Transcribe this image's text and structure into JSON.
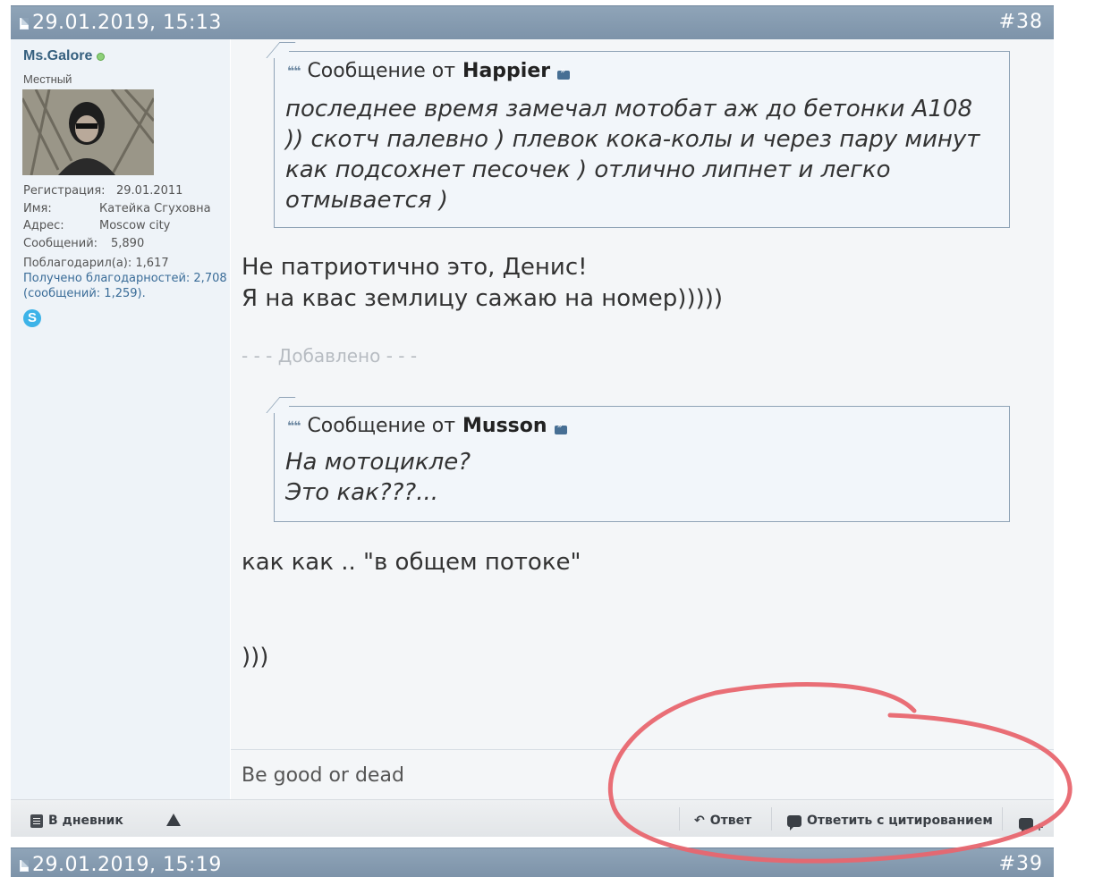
{
  "post_top": {
    "date": "29.01.2019, 15:13",
    "number": "#38"
  },
  "post_bottom": {
    "date": "29.01.2019, 15:19",
    "number": "#39"
  },
  "user": {
    "name": "Ms.Galore",
    "rank": "Местный",
    "info": [
      {
        "label": "Регистрация:",
        "value": "29.01.2011"
      },
      {
        "label": "Имя:",
        "value": "Катейка Сгуховна"
      },
      {
        "label": "Адрес:",
        "value": "Moscow city"
      },
      {
        "label": "Сообщений:",
        "value": "5,890"
      }
    ],
    "thanked": "Поблагодарил(а):  1,617",
    "received": "Получено благодарностей: 2,708 (сообщений: 1,259).",
    "skype_label": "S"
  },
  "quote1": {
    "prefix": "Сообщение от",
    "author": "Happier",
    "text": "последнее время замечал мотобат аж до бетонки А108\n)) скотч палевно ) плевок кока-колы и через пару минут\nкак подсохнет песочек ) отлично липнет и легко\nотмывается )"
  },
  "message1": "Не патриотично это, Денис!\nЯ на квас землицу сажаю на номер)))))",
  "added_label": "- - - Добавлено - - -",
  "quote2": {
    "prefix": "Сообщение от",
    "author": "Musson",
    "text": "На мотоцикле?\nЭто как???..."
  },
  "message2": "как как .. \"в общем потоке\"",
  "message3": ")))",
  "signature": "Be good or dead",
  "actions": {
    "diary": "В дневник",
    "reply": "Ответ",
    "reply_quote": "Ответить с цитированием"
  },
  "colors": {
    "header": "#8fa4b8",
    "annotation": "#e8666f",
    "username": "#36607f"
  },
  "icons": [
    "doc-icon",
    "online-icon",
    "quote-icon",
    "view-post-icon",
    "skype-icon",
    "diary-icon",
    "warning-icon",
    "reply-icon",
    "quote-reply-icon",
    "multi-quote-icon"
  ]
}
